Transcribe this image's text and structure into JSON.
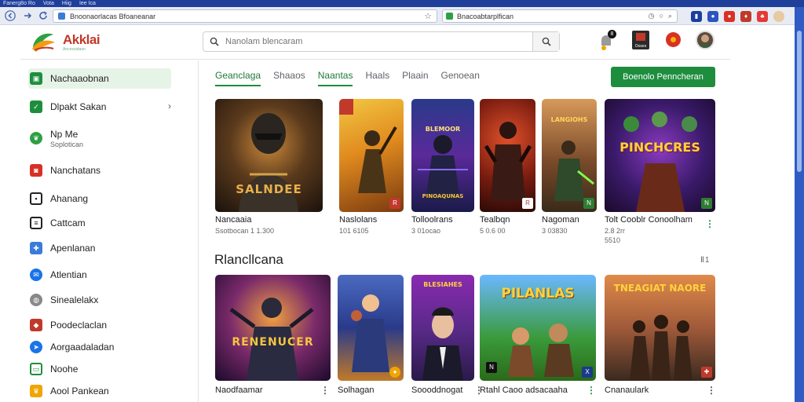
{
  "os_menubar": {
    "items": [
      "Fanerg8o Ro",
      "Vota",
      "Hiig",
      "Iee Ica"
    ]
  },
  "browser": {
    "back_icon": "back-arrow-icon",
    "forward_icon": "forward-arrow-icon",
    "reload_icon": "reload-icon",
    "address_value": "Bnoonaorlacas Bfoaneanar",
    "omni_value": "Bnacoabtarplfican"
  },
  "header": {
    "brand_name": "Akklai",
    "brand_tag": "Ancnsoidaon",
    "search_placeholder": "Nanolam blencaram",
    "notification_count": "8",
    "game_icon_label": "Ooses"
  },
  "sidebar": {
    "items": [
      {
        "label": "Nachaaobnan",
        "icon": "home-icon",
        "color": "#1e8e3e"
      },
      {
        "label": "Dlpakt Sakan",
        "icon": "checkmark-icon",
        "color": "#1e8e3e"
      },
      {
        "label": "Np Me",
        "sub": "Soplotican",
        "icon": "leaf-icon",
        "color": "#2ea043"
      },
      {
        "label": "Nanchatans",
        "icon": "gamepad-icon",
        "color": "#d93025"
      },
      {
        "label": "Ahanang",
        "icon": "grid-icon",
        "color": "#222222"
      },
      {
        "label": "Cattcam",
        "icon": "list-icon",
        "color": "#222222"
      },
      {
        "label": "Apenlanan",
        "icon": "puzzle-icon",
        "color": "#3c7bd8"
      },
      {
        "label": "Atlentian",
        "icon": "chat-icon",
        "color": "#1a73e8"
      },
      {
        "label": "Sinealelakx",
        "icon": "globe-icon",
        "color": "#777777"
      },
      {
        "label": "Poodeclaclan",
        "icon": "controller-icon",
        "color": "#c0392b"
      },
      {
        "label": "Aorgaadaladan",
        "icon": "compass-icon",
        "color": "#1a73e8"
      },
      {
        "label": "Noohe",
        "icon": "message-icon",
        "color": "#1e8e3e"
      },
      {
        "label": "Aool Pankean",
        "icon": "trophy-icon",
        "color": "#f0a500"
      }
    ]
  },
  "tabs": [
    {
      "label": "Geanclaga"
    },
    {
      "label": "Shaaos"
    },
    {
      "label": "Naantas"
    },
    {
      "label": "Haals"
    },
    {
      "label": "Plaain"
    },
    {
      "label": "Genoean"
    }
  ],
  "cta_label": "Boenolo Penncheran",
  "row1": [
    {
      "title": "Nancaaia",
      "meta": "Ssotbocan 1 1.300",
      "art_text": "SALNDEE"
    },
    {
      "title": "Naslolans",
      "meta": "101 6105",
      "art_text": ""
    },
    {
      "title": "Tolloolrans",
      "meta": "3 01ocao",
      "art_text": "PINOAQUNAS"
    },
    {
      "title": "Tealbqn",
      "meta": "5 0.6 00",
      "art_text": ""
    },
    {
      "title": "Nagoman",
      "meta": "3 03830",
      "art_text": "LANGIOHS"
    },
    {
      "title": "Tolt Cooblr Conoolham",
      "meta": "2.8 2rr",
      "meta2": "5510",
      "art_text": "PINCHCRES"
    }
  ],
  "section": {
    "title": "Rlancllcana",
    "more": "Ⅱ1"
  },
  "row2": [
    {
      "title": "Naodfaamar",
      "meta": "",
      "art_text": "RENENUCER"
    },
    {
      "title": "Solhagan",
      "meta": "",
      "art_text": ""
    },
    {
      "title": "Soooddnogat",
      "meta": "",
      "art_text": "BLESIAHES"
    },
    {
      "title": "Rtahl Caoo adsacaaha",
      "meta": "",
      "art_text": "PILANLAS"
    },
    {
      "title": "Cnanaulark",
      "meta": "",
      "art_text": "TNEAGIAT NAORE"
    }
  ]
}
